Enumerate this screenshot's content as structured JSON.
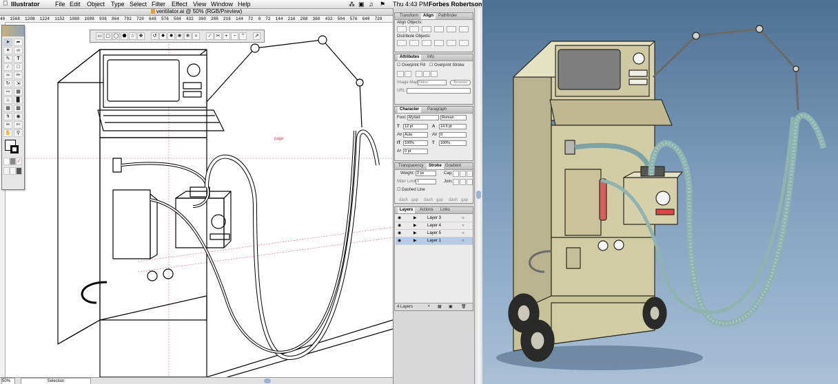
{
  "menubar": {
    "app_name": "Illustrator",
    "menus": [
      "File",
      "Edit",
      "Object",
      "Type",
      "Select",
      "Filter",
      "Effect",
      "View",
      "Window",
      "Help"
    ],
    "clock": "Thu 4:43 PM",
    "user": "Forbes Robertson"
  },
  "document": {
    "title": "ventilator.ai @ 50% (RGB/Preview)",
    "ruler_numbers": "40  1568  1208  1224  1152  1080  1008  936  864  792  720  648  576  504  432  360  288  216  144  72  0  72  144  216  288  360  432  504  576  648  720",
    "page_label": "page",
    "zoom": "50%",
    "status_tool": "Selection"
  },
  "panels": {
    "align": {
      "tabs": [
        "Transform",
        "Align",
        "Pathfinder"
      ],
      "active_tab": "Align",
      "align_objects": "Align Objects:",
      "distribute_objects": "Distribute Objects:"
    },
    "attributes": {
      "tabs": [
        "Attributes",
        "Info"
      ],
      "overprint_fill": "Overprint Fill",
      "overprint_stroke": "Overprint Stroke",
      "image_map_label": "Image Map:",
      "image_map_value": "None",
      "browser_button": "Browser",
      "url_label": "URL:"
    },
    "character": {
      "tabs": [
        "Character",
        "Paragraph"
      ],
      "font_label": "Font:",
      "font_family": "Myriad",
      "font_style": "Roman",
      "size": "12 pt",
      "leading": "14.5 pt",
      "kerning": "Auto",
      "tracking": "0",
      "vscale": "100%",
      "hscale": "100%",
      "baseline": "0 pt"
    },
    "stroke": {
      "tabs": [
        "Transparency",
        "Stroke",
        "Gradient"
      ],
      "weight_label": "Weight:",
      "weight_value": "2 px",
      "cap_label": "Cap:",
      "miter_label": "Miter Limit:",
      "miter_value": "4",
      "join_label": "Join:",
      "dashed_label": "Dashed Line",
      "dash_labels": [
        "dash",
        "gap",
        "dash",
        "gap",
        "dash",
        "gap"
      ]
    },
    "layers": {
      "tabs": [
        "Layers",
        "Actions",
        "Links"
      ],
      "items": [
        {
          "name": "Layer 3"
        },
        {
          "name": "Layer 4"
        },
        {
          "name": "Layer 5"
        },
        {
          "name": "Layer 1"
        }
      ],
      "count": "4 Layers"
    }
  }
}
